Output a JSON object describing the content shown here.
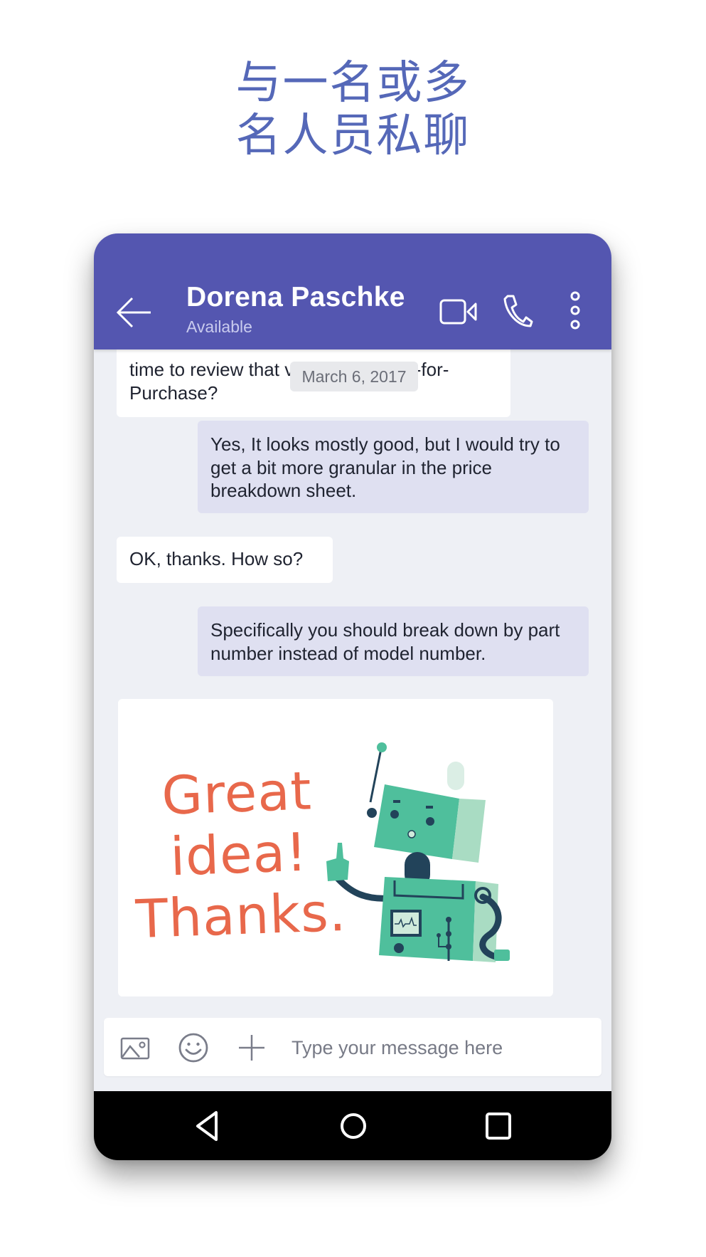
{
  "headline": {
    "line1": "与一名或多",
    "line2": "名人员私聊"
  },
  "header": {
    "contact_name": "Dorena Paschke",
    "status": "Available",
    "icons": {
      "back": "arrow-left-icon",
      "video": "video-camera-icon",
      "call": "phone-icon",
      "more": "more-vertical-icon"
    }
  },
  "chat": {
    "date_separator": "March 6, 2017",
    "messages": [
      {
        "direction": "incoming",
        "text": "time to review that vendor Request-for-Purchase?"
      },
      {
        "direction": "outgoing",
        "text": "Yes, It looks mostly good, but I would try to get a bit more granular in the price breakdown sheet."
      },
      {
        "direction": "incoming",
        "text": "OK, thanks. How so?"
      },
      {
        "direction": "outgoing",
        "text": "Specifically you should break down by part number instead of model number."
      },
      {
        "direction": "incoming",
        "type": "sticker",
        "sticker_text": [
          "Great",
          "idea!",
          "Thanks."
        ],
        "sticker_icon": "robot-sticker-icon"
      }
    ]
  },
  "composer": {
    "placeholder": "Type your message here",
    "value": "",
    "icons": {
      "image": "image-icon",
      "emoji": "emoji-icon",
      "attach": "plus-icon"
    }
  },
  "navbar": {
    "icons": {
      "back": "nav-back-icon",
      "home": "nav-home-icon",
      "recents": "nav-recents-icon"
    }
  },
  "colors": {
    "brand": "#5456b0",
    "headline": "#5568b8",
    "outgoing_bubble": "#dfe0f1",
    "incoming_bubble": "#ffffff",
    "chat_background": "#eef0f5",
    "sticker_text": "#e8684b",
    "robot_green": "#4fbf9c",
    "robot_dark": "#22435a"
  }
}
